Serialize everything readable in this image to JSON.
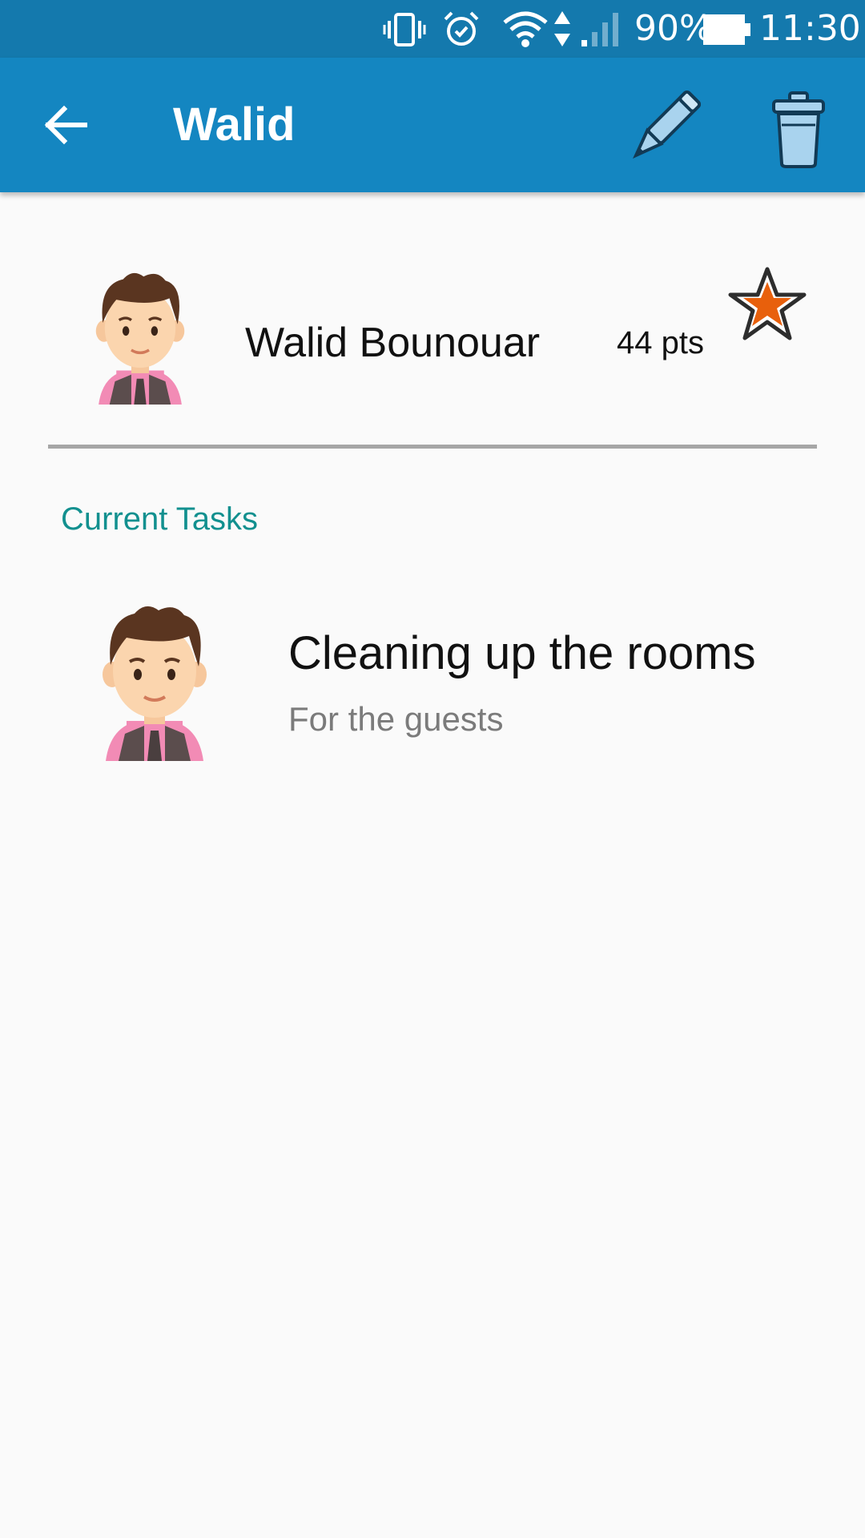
{
  "status_bar": {
    "battery_percent": "90%",
    "time": "11:30",
    "icons": [
      "vibrate-icon",
      "alarm-icon",
      "wifi-icon",
      "data-arrows-icon",
      "signal-icon",
      "battery-icon"
    ]
  },
  "app_bar": {
    "title": "Walid",
    "back_icon": "arrow-left-icon",
    "edit_icon": "pencil-icon",
    "delete_icon": "trash-icon",
    "background": "#1486c1"
  },
  "profile": {
    "name": "Walid Bounouar",
    "points": "44 pts",
    "avatar_icon": "man-avatar-icon",
    "badge_icon": "star-icon"
  },
  "sections": {
    "current_tasks": "Current Tasks"
  },
  "tasks": [
    {
      "title": "Cleaning up the rooms",
      "subtitle": "For the guests",
      "avatar_icon": "man-avatar-icon"
    }
  ],
  "colors": {
    "status_bar": "#1479ad",
    "accent_teal": "#12908f",
    "star_orange": "#e8600c"
  }
}
